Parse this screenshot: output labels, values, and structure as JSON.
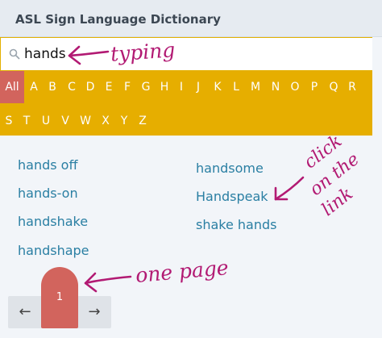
{
  "header": {
    "title": "ASL Sign Language Dictionary"
  },
  "search": {
    "value": "hands"
  },
  "alphabet": {
    "items": [
      "All",
      "A",
      "B",
      "C",
      "D",
      "E",
      "F",
      "G",
      "H",
      "I",
      "J",
      "K",
      "L",
      "M",
      "N",
      "O",
      "P",
      "Q",
      "R",
      "S",
      "T",
      "U",
      "V",
      "W",
      "X",
      "Y",
      "Z"
    ],
    "selected": "All"
  },
  "results": {
    "left": [
      "hands off",
      "hands-on",
      "handshake",
      "handshape"
    ],
    "right": [
      "handsome",
      "Handspeak",
      "shake hands"
    ]
  },
  "pagination": {
    "prev": "←",
    "current": "1",
    "next": "→"
  },
  "annotations": {
    "typing": "typing",
    "click_line1": "click",
    "click_line2": "on the",
    "click_line3": "link",
    "one_page": "one page"
  },
  "colors": {
    "accent_bar": "#e6ae00",
    "active": "#d2645d",
    "link": "#2a7fa3",
    "annotation": "#b21a73"
  }
}
